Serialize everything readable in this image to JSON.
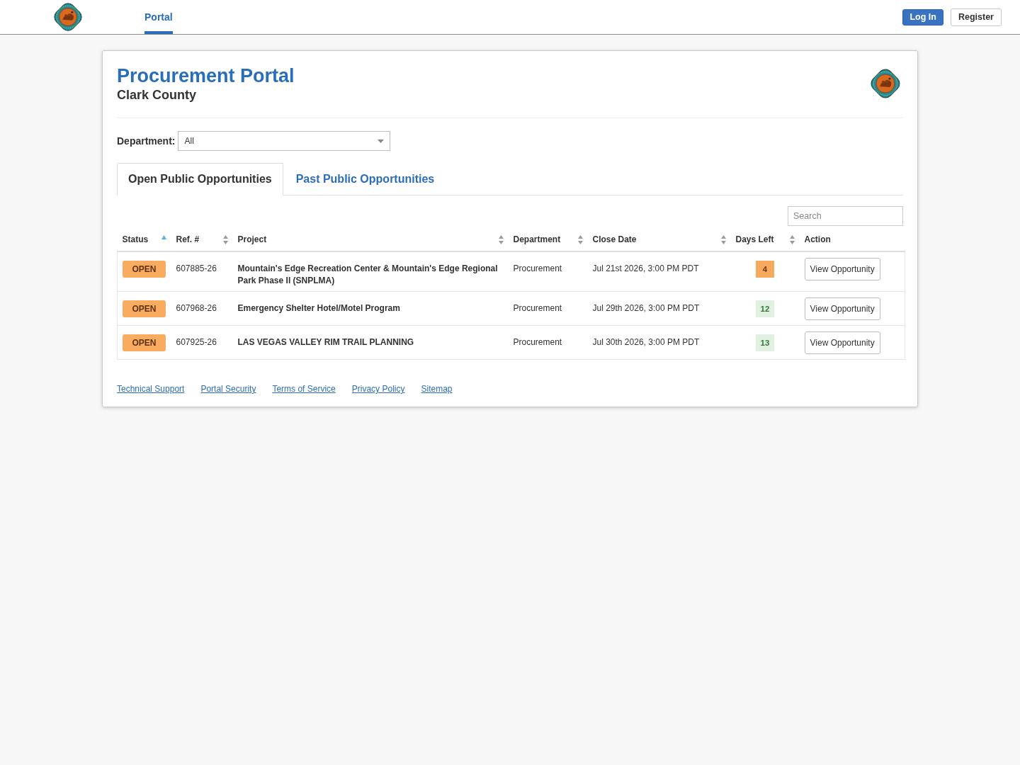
{
  "navbar": {
    "links": [
      {
        "label": "Portal",
        "selected": true
      }
    ],
    "buttons": [
      {
        "label": "Log In",
        "kind": "primary"
      },
      {
        "label": "Register",
        "kind": "secondary"
      }
    ]
  },
  "header": {
    "title": "Procurement Portal",
    "subtitle": "Clark County"
  },
  "department_filter": {
    "label": "Department:",
    "value": "All"
  },
  "tabs": [
    {
      "label": "Open Public Opportunities",
      "selected": true
    },
    {
      "label": "Past Public Opportunities",
      "selected": false
    }
  ],
  "search": {
    "placeholder": "Search"
  },
  "table": {
    "columns": [
      {
        "label": "Status",
        "sorted": true
      },
      {
        "label": "Ref. #",
        "sorted": false
      },
      {
        "label": "Project",
        "sorted": false
      },
      {
        "label": "Department",
        "sorted": false
      },
      {
        "label": "Close Date",
        "sorted": false
      },
      {
        "label": "Days Left",
        "sorted": false
      },
      {
        "label": "Action"
      }
    ],
    "rows": [
      {
        "status": "OPEN",
        "ref": "607885-26",
        "project": "Mountain's Edge Recreation Center & Mountain's Edge Regional Park Phase II (SNPLMA)",
        "department": "Procurement",
        "close_date": "Jul 21st 2026, 3:00 PM PDT",
        "days_left": "4",
        "urgent": true,
        "action": "View Opportunity"
      },
      {
        "status": "OPEN",
        "ref": "607968-26",
        "project": "Emergency Shelter Hotel/Motel Program",
        "department": "Procurement",
        "close_date": "Jul 29th 2026, 3:00 PM PDT",
        "days_left": "12",
        "urgent": false,
        "action": "View Opportunity"
      },
      {
        "status": "OPEN",
        "ref": "607925-26",
        "project": "LAS VEGAS VALLEY RIM TRAIL PLANNING",
        "department": "Procurement",
        "close_date": "Jul 30th 2026, 3:00 PM PDT",
        "days_left": "13",
        "urgent": false,
        "action": "View Opportunity"
      }
    ]
  },
  "footer_links": [
    "Technical Support",
    "Portal Security",
    "Terms of Service",
    "Privacy Policy",
    "Sitemap"
  ]
}
